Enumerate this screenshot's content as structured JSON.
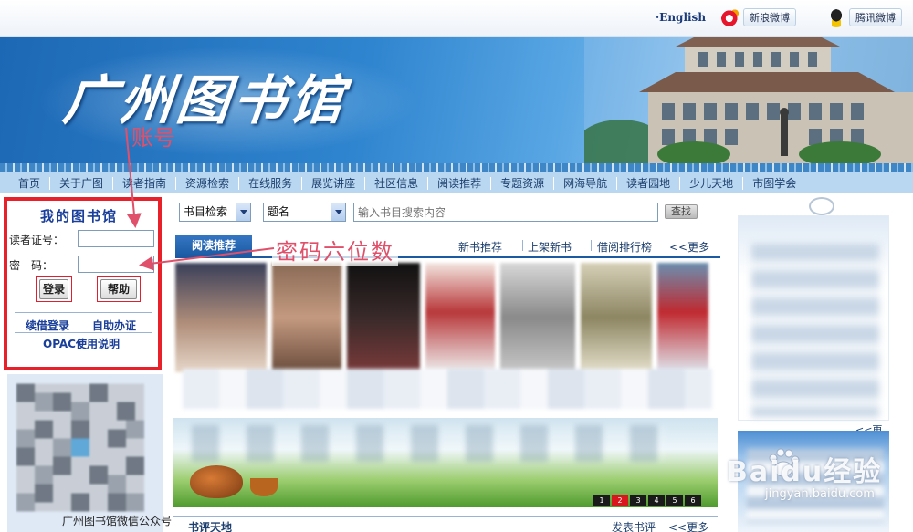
{
  "topbar": {
    "english": "·English",
    "sina_weibo": "新浪微博",
    "tencent_weibo": "腾讯微博"
  },
  "banner": {
    "title": "广州图书馆",
    "annotation_account": "账号"
  },
  "nav": {
    "items": [
      "首页",
      "关于广图",
      "读者指南",
      "资源检索",
      "在线服务",
      "展览讲座",
      "社区信息",
      "阅读推荐",
      "专题资源",
      "网海导航",
      "读者园地",
      "少儿天地",
      "市图学会"
    ]
  },
  "login": {
    "title": "我的图书馆",
    "card_label": "读者证号：",
    "password_label": "密　码：",
    "login_button": "登录",
    "help_button": "帮助",
    "borrow_login": "续借登录",
    "self_service": "自助办证",
    "opac_help": "OPAC使用说明"
  },
  "qr": {
    "caption": "广州图书馆微信公众号"
  },
  "search": {
    "type_select": "书目检索",
    "field_select": "题名",
    "placeholder": "输入书目搜索内容",
    "button": "查找"
  },
  "reading": {
    "active_tab": "阅读推荐",
    "annotation_password": "密码六位数",
    "tabs": [
      "新书推荐",
      "上架新书",
      "借阅排行榜"
    ],
    "more": "<<更多"
  },
  "ad": {
    "pages": [
      "1",
      "2",
      "3",
      "4",
      "5",
      "6"
    ],
    "active_page": "2"
  },
  "review": {
    "title": "书评天地",
    "post": "发表书评",
    "more": "<<更多"
  },
  "right": {
    "more": "<<更多"
  },
  "watermark": {
    "text": "Baidu经验",
    "url": "jingyan.baidu.com"
  },
  "colors": {
    "annotation": "#e0506a",
    "highlight_frame": "#e8202a",
    "nav_text": "#1d3f6e",
    "link_blue": "#1a3f9a"
  }
}
